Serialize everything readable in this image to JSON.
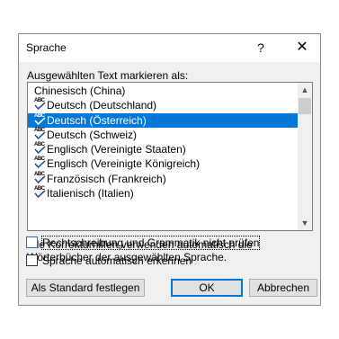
{
  "title": "Sprache",
  "help_glyph": "?",
  "close_glyph": "✕",
  "list_label": "Ausgewählten Text markieren als:",
  "languages": [
    {
      "label": "Chinesisch (China)",
      "spellcheck": false,
      "selected": false
    },
    {
      "label": "Deutsch (Deutschland)",
      "spellcheck": true,
      "selected": false
    },
    {
      "label": "Deutsch (Österreich)",
      "spellcheck": true,
      "selected": true
    },
    {
      "label": "Deutsch (Schweiz)",
      "spellcheck": true,
      "selected": false
    },
    {
      "label": "Englisch (Vereinigte Staaten)",
      "spellcheck": true,
      "selected": false
    },
    {
      "label": "Englisch (Vereinigte Königreich)",
      "spellcheck": true,
      "selected": false
    },
    {
      "label": "Französisch (Frankreich)",
      "spellcheck": true,
      "selected": false
    },
    {
      "label": "Italienisch (Italien)",
      "spellcheck": true,
      "selected": false
    }
  ],
  "spell_icon_text": "ABC",
  "info_text": "Alle Korrekturhilfen verwenden automatisch die Wörterbücher der ausgewählten Sprache.",
  "checkbox_no_proofing": {
    "label": "Rechtschreibung und Grammatik nicht prüfen",
    "checked": false
  },
  "checkbox_autodetect": {
    "label": "Sprache automatisch erkennen",
    "checked": false
  },
  "buttons": {
    "set_default": "Als Standard festlegen",
    "ok": "OK",
    "cancel": "Abbrechen"
  },
  "colors": {
    "selection": "#0078d7",
    "dialog_bg": "#f0f0f0"
  }
}
